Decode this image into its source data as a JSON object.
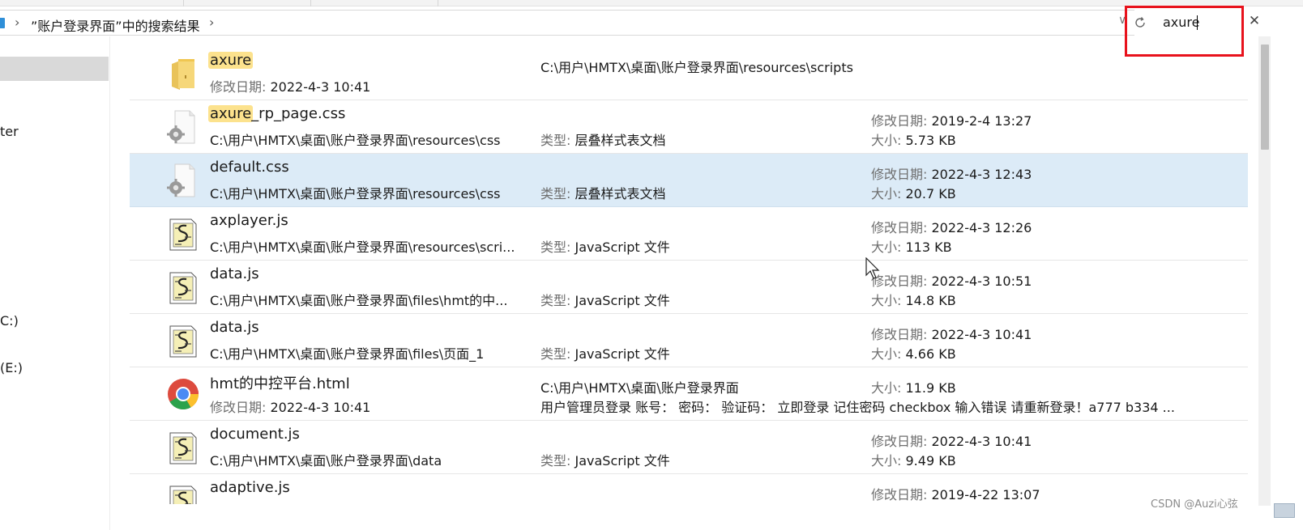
{
  "address_bar": {
    "crumb": "”账户登录界面”中的搜索结果",
    "separator": "›",
    "dropdown": "∨",
    "refresh_icon": "refresh-icon"
  },
  "search": {
    "value": "axure",
    "close_glyph": "✕"
  },
  "nav": {
    "items": [
      "ter",
      "C:)",
      "(E:)"
    ]
  },
  "labels": {
    "modified": "修改日期:",
    "type": "类型:",
    "size": "大小:"
  },
  "files": [
    {
      "name_hl": "axure",
      "name_rest": "",
      "icon": "folder-icon",
      "left_label": "修改日期:",
      "left_value": "2022-4-3 10:41",
      "mid_top": "C:\\用户\\HMTX\\桌面\\账户登录界面\\resources\\scripts",
      "mid_label": "",
      "mid_value": "",
      "right_top_label": "",
      "right_top_value": "",
      "right_bottom_label": "",
      "right_bottom_value": ""
    },
    {
      "name_hl": "axure",
      "name_rest": "_rp_page.css",
      "icon": "css-file-icon",
      "left_label": "",
      "left_value": "C:\\用户\\HMTX\\桌面\\账户登录界面\\resources\\css",
      "mid_top": "",
      "mid_label": "类型:",
      "mid_value": "层叠样式表文档",
      "right_top_label": "修改日期:",
      "right_top_value": "2019-2-4 13:27",
      "right_bottom_label": "大小:",
      "right_bottom_value": "5.73 KB"
    },
    {
      "name_hl": "",
      "name_rest": "default.css",
      "icon": "css-file-icon",
      "left_label": "",
      "left_value": "C:\\用户\\HMTX\\桌面\\账户登录界面\\resources\\css",
      "mid_top": "",
      "mid_label": "类型:",
      "mid_value": "层叠样式表文档",
      "right_top_label": "修改日期:",
      "right_top_value": "2022-4-3 12:43",
      "right_bottom_label": "大小:",
      "right_bottom_value": "20.7 KB"
    },
    {
      "name_hl": "",
      "name_rest": "axplayer.js",
      "icon": "js-file-icon",
      "left_label": "",
      "left_value": "C:\\用户\\HMTX\\桌面\\账户登录界面\\resources\\scri...",
      "mid_top": "",
      "mid_label": "类型:",
      "mid_value": "JavaScript 文件",
      "right_top_label": "修改日期:",
      "right_top_value": "2022-4-3 12:26",
      "right_bottom_label": "大小:",
      "right_bottom_value": "113 KB"
    },
    {
      "name_hl": "",
      "name_rest": "data.js",
      "icon": "js-file-icon",
      "left_label": "",
      "left_value": "C:\\用户\\HMTX\\桌面\\账户登录界面\\files\\hmt的中...",
      "mid_top": "",
      "mid_label": "类型:",
      "mid_value": "JavaScript 文件",
      "right_top_label": "修改日期:",
      "right_top_value": "2022-4-3 10:51",
      "right_bottom_label": "大小:",
      "right_bottom_value": "14.8 KB"
    },
    {
      "name_hl": "",
      "name_rest": "data.js",
      "icon": "js-file-icon",
      "left_label": "",
      "left_value": "C:\\用户\\HMTX\\桌面\\账户登录界面\\files\\页面_1",
      "mid_top": "",
      "mid_label": "类型:",
      "mid_value": "JavaScript 文件",
      "right_top_label": "修改日期:",
      "right_top_value": "2022-4-3 10:41",
      "right_bottom_label": "大小:",
      "right_bottom_value": "4.66 KB"
    },
    {
      "name_hl": "",
      "name_rest": "hmt的中控平台.html",
      "icon": "chrome-icon",
      "left_label": "修改日期:",
      "left_value": "2022-4-3 10:41",
      "mid_top": "C:\\用户\\HMTX\\桌面\\账户登录界面",
      "mid_label": "",
      "mid_value": "用户管理员登录 账号： 密码： 验证码：  立即登录 记住密码 checkbox 输入错误 请重新登录！a777 b334 ...",
      "right_top_label": "大小:",
      "right_top_value": "11.9 KB",
      "right_bottom_label": "",
      "right_bottom_value": ""
    },
    {
      "name_hl": "",
      "name_rest": "document.js",
      "icon": "js-file-icon",
      "left_label": "",
      "left_value": "C:\\用户\\HMTX\\桌面\\账户登录界面\\data",
      "mid_top": "",
      "mid_label": "类型:",
      "mid_value": "JavaScript 文件",
      "right_top_label": "修改日期:",
      "right_top_value": "2022-4-3 10:41",
      "right_bottom_label": "大小:",
      "right_bottom_value": "9.49 KB"
    },
    {
      "name_hl": "",
      "name_rest": "adaptive.js",
      "icon": "js-file-icon",
      "left_label": "",
      "left_value": "",
      "mid_top": "",
      "mid_label": "",
      "mid_value": "",
      "right_top_label": "修改日期:",
      "right_top_value": "2019-4-22 13:07",
      "right_bottom_label": "",
      "right_bottom_value": ""
    }
  ],
  "watermark": "CSDN @Auzi心弦",
  "colors": {
    "selected_row": "#dcebf7",
    "match_highlight": "#fce28d",
    "annotation_red": "#e8121c"
  }
}
